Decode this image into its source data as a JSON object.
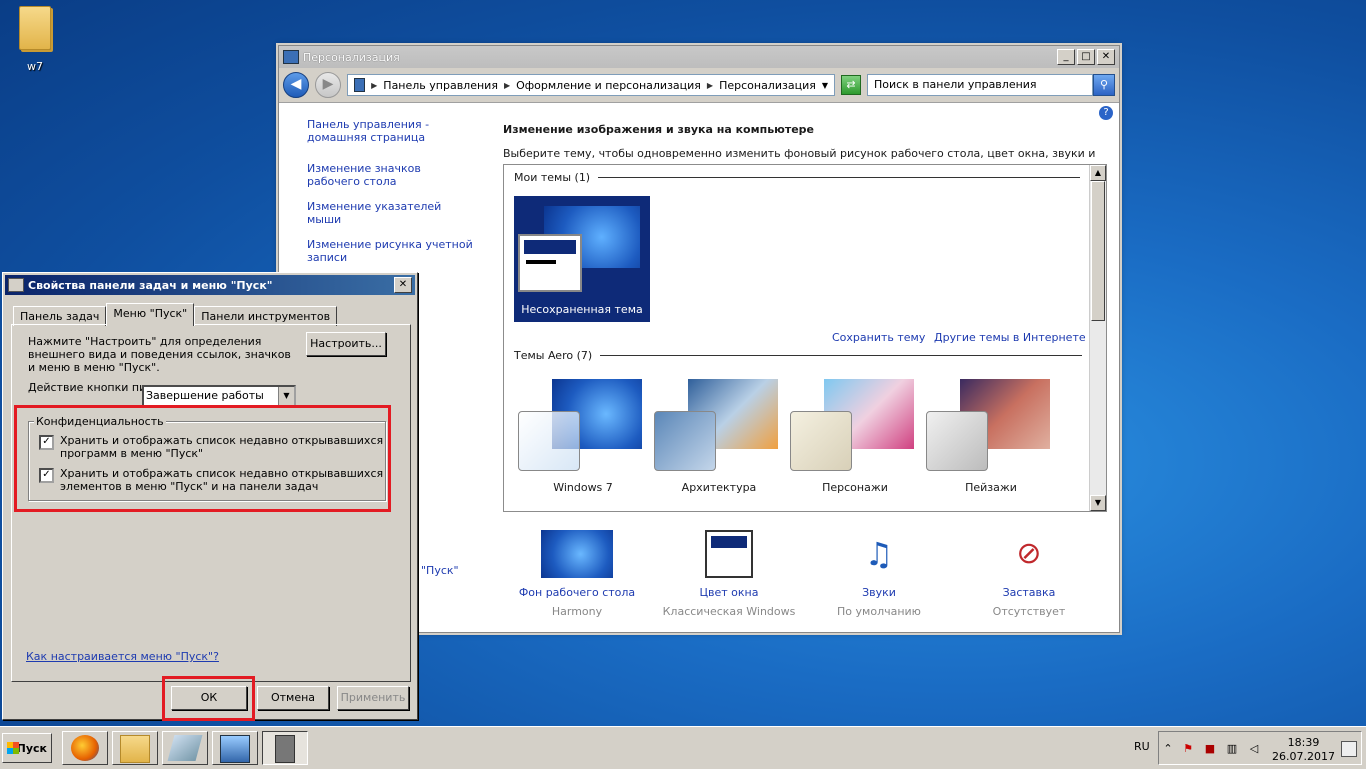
{
  "desktop": {
    "icon_label": "w7"
  },
  "personalization": {
    "title": "Персонализация",
    "address": {
      "crumbs": [
        "Панель управления",
        "Оформление и персонализация",
        "Персонализация"
      ]
    },
    "search_placeholder": "Поиск в панели управления",
    "sidebar": [
      "Панель управления - домашняя страница",
      "Изменение значков рабочего стола",
      "Изменение указателей мыши",
      "Изменение рисунка учетной записи"
    ],
    "heading": "Изменение изображения и звука на компьютере",
    "description": "Выберите тему, чтобы одновременно изменить фоновый рисунок рабочего стола, цвет окна, звуки и заставку.",
    "my_themes_header": "Мои темы (1)",
    "unsaved_theme": "Несохраненная тема",
    "save_theme": "Сохранить тему",
    "other_themes": "Другие темы в Интернете",
    "aero_header": "Темы Aero (7)",
    "aero_themes": [
      "Windows 7",
      "Архитектура",
      "Персонажи",
      "Пейзажи"
    ],
    "bottom": [
      {
        "label": "Фон рабочего стола",
        "sub": "Harmony"
      },
      {
        "label": "Цвет окна",
        "sub": "Классическая Windows"
      },
      {
        "label": "Звуки",
        "sub": "По умолчанию"
      },
      {
        "label": "Заставка",
        "sub": "Отсутствует"
      }
    ],
    "pusk_fragment": "\"Пуск\""
  },
  "dialog": {
    "title": "Свойства панели задач и меню \"Пуск\"",
    "tabs": [
      "Панель задач",
      "Меню \"Пуск\"",
      "Панели инструментов"
    ],
    "intro": "Нажмите \"Настроить\" для определения внешнего вида и поведения ссылок, значков и меню в меню \"Пуск\".",
    "customize_btn": "Настроить...",
    "power_label": "Действие кнопки питания:",
    "power_value": "Завершение работы",
    "privacy_legend": "Конфиденциальность",
    "check1": "Хранить и отображать список недавно открывавшихся программ в меню \"Пуск\"",
    "check2": "Хранить и отображать список недавно открывавшихся элементов в меню \"Пуск\" и на панели задач",
    "help_link": "Как настраивается меню \"Пуск\"?",
    "ok": "ОК",
    "cancel": "Отмена",
    "apply": "Применить"
  },
  "taskbar": {
    "start": "Пуск",
    "lang": "RU",
    "time": "18:39",
    "date": "26.07.2017"
  }
}
